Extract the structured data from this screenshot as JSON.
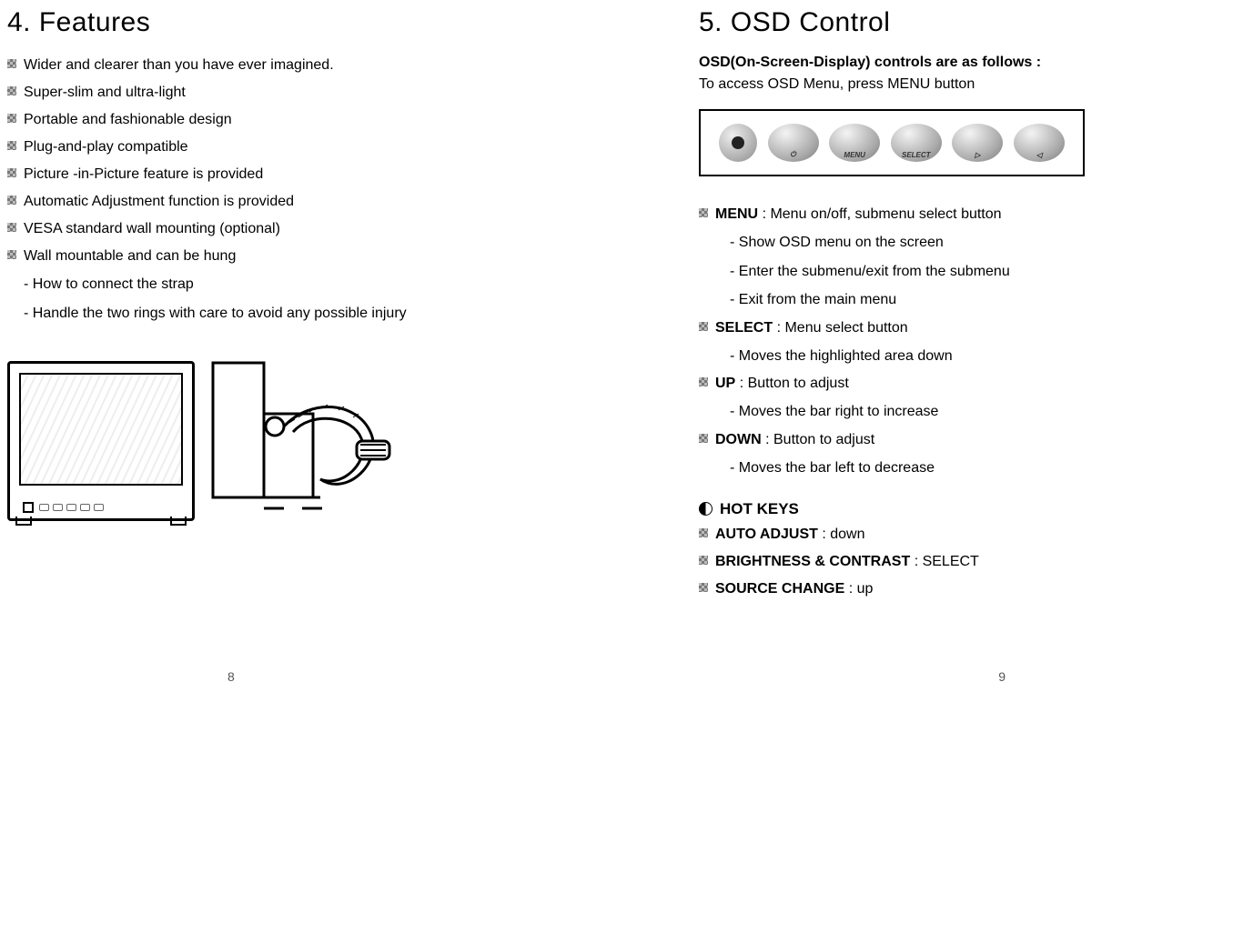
{
  "left": {
    "heading": "4. Features",
    "items": [
      "Wider and clearer than you have ever imagined.",
      "Super-slim and ultra-light",
      "Portable and fashionable design",
      "Plug-and-play compatible",
      "Picture -in-Picture feature is provided",
      "Automatic Adjustment function is provided",
      "VESA standard wall mounting (optional)",
      "Wall mountable and can be hung"
    ],
    "subitems": [
      "- How to connect the strap",
      "- Handle the two rings with care to avoid any possible injury"
    ],
    "page_no": "8"
  },
  "right": {
    "heading": "5. OSD Control",
    "intro_bold": "OSD(On-Screen-Display) controls are as follows :",
    "intro": "To access OSD Menu, press MENU button",
    "buttons": {
      "power": "●",
      "b1": "⏻",
      "b2": "MENU",
      "b3": "SELECT",
      "b4": "▷",
      "b5": "◁"
    },
    "controls": [
      {
        "name": "MENU",
        "desc": ": Menu on/off, submenu select button",
        "subs": [
          "- Show OSD menu on the screen",
          "- Enter the submenu/exit from the submenu",
          "- Exit from the main menu"
        ]
      },
      {
        "name": "SELECT",
        "desc": ": Menu select button",
        "subs": [
          "- Moves the highlighted area down"
        ]
      },
      {
        "name": "UP",
        "desc": ": Button to adjust",
        "subs": [
          "- Moves the bar right to increase"
        ]
      },
      {
        "name": "DOWN",
        "desc": ": Button to adjust",
        "subs": [
          "- Moves the bar left to decrease"
        ]
      }
    ],
    "hotkeys_title": "HOT KEYS",
    "hotkeys": [
      {
        "name": "AUTO ADJUST",
        "desc": ": down"
      },
      {
        "name": "BRIGHTNESS & CONTRAST",
        "desc": ": SELECT"
      },
      {
        "name": "SOURCE CHANGE",
        "desc": ": up"
      }
    ],
    "page_no": "9"
  }
}
